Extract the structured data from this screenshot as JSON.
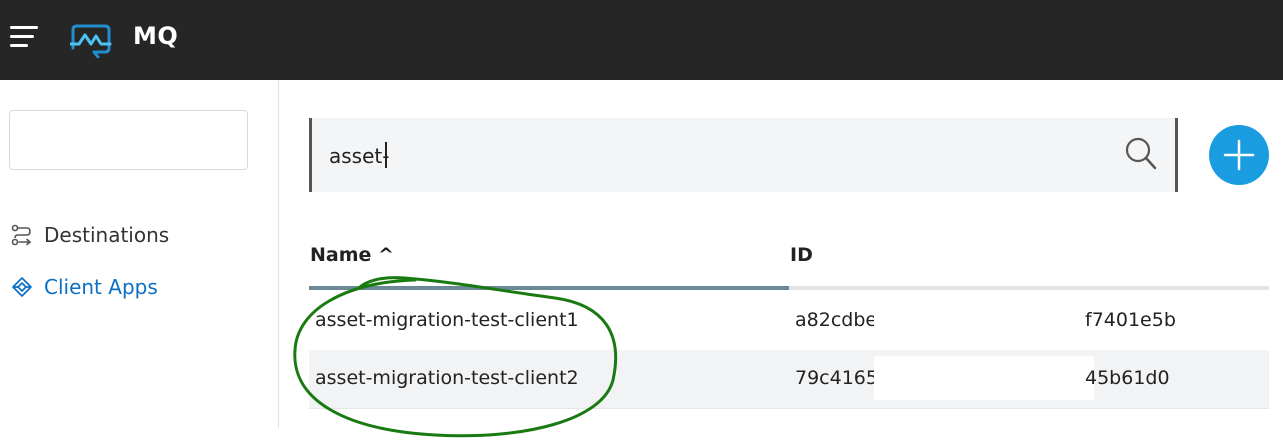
{
  "header": {
    "app_title": "MQ",
    "menu_icon": "hamburger-menu-icon",
    "logo_icon": "mq-logo-icon"
  },
  "sidebar": {
    "items": [
      {
        "label": "Destinations",
        "icon": "route-icon",
        "active": false
      },
      {
        "label": "Client Apps",
        "icon": "client-apps-icon",
        "active": true
      }
    ]
  },
  "search": {
    "value": "asset-",
    "icon": "search-icon"
  },
  "add_button": {
    "icon": "plus-icon"
  },
  "table": {
    "columns": [
      {
        "label": "Name ^",
        "sorted": "ascending"
      },
      {
        "label": "ID"
      }
    ],
    "rows": [
      {
        "name": "asset-migration-test-client1",
        "id_start": "a82cdbe",
        "id_end": "f7401e5b"
      },
      {
        "name": "asset-migration-test-client2",
        "id_start": "79c4165",
        "id_end": "45b61d0"
      }
    ]
  },
  "colors": {
    "topbar": "#262626",
    "accent": "#1a9ce0",
    "active_nav": "#0b6fc4",
    "annotation": "#1a7a12"
  }
}
